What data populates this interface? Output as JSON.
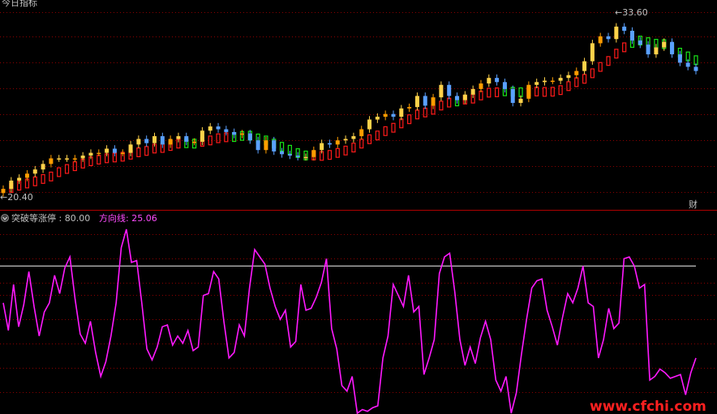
{
  "top_panel": {
    "title_text": "今日指标",
    "price_high_label": "33.60",
    "price_low_label": "20.40",
    "corner_label": "财",
    "colors": {
      "background": "#000000",
      "grid": "#8b0000",
      "up_candle": "#ffd24a",
      "up_candle_alt": "#ff9d00",
      "down_candle": "#5aa0ff",
      "band_red": "#ff1a1a",
      "band_green": "#19e619",
      "axis_text": "#c0c0c0"
    }
  },
  "bottom_panel": {
    "indicator_name": "突破等涨停",
    "level_value": "80.00",
    "line_name": "方向线",
    "line_value": "25.06",
    "colors": {
      "line": "#ff19ff",
      "level_line": "#c0c0c0",
      "name_text": "#c0c0c0",
      "line_label_text": "#ff4dff"
    }
  },
  "watermark": {
    "text": "www.cfchi.com",
    "color": "#ff2020"
  },
  "chart_data": [
    {
      "type": "line",
      "title": "",
      "ylabel": "",
      "ylim": [
        20.4,
        33.6
      ],
      "legend": "none",
      "grid": true,
      "series": [
        {
          "name": "",
          "values": [
            20.8,
            21.4,
            21.6,
            21.9,
            22.2,
            22.6,
            23.0,
            23.0,
            23.0,
            23.0,
            23.2,
            23.4,
            23.4,
            23.7,
            23.4,
            23.4,
            24.0,
            24.4,
            24.1,
            24.6,
            24.0,
            24.4,
            24.6,
            24.2,
            24.2,
            25.0,
            25.3,
            25.1,
            24.9,
            24.7,
            24.8,
            24.3,
            23.6,
            24.3,
            23.5,
            23.3,
            23.2,
            23.1,
            23.1,
            23.6,
            24.1,
            24.0,
            24.3,
            24.4,
            24.6,
            25.1,
            25.8,
            26.0,
            26.2,
            26.0,
            26.6,
            26.7,
            27.5,
            26.8,
            27.4,
            28.3,
            27.5,
            27.2,
            27.6,
            28.0,
            28.4,
            28.8,
            28.5,
            28.0,
            27.0,
            27.3,
            28.3,
            28.5,
            28.6,
            28.6,
            28.8,
            29.0,
            29.3,
            30.0,
            31.3,
            31.8,
            31.6,
            32.5,
            32.2,
            31.5,
            31.2,
            30.5,
            31.0,
            31.4,
            30.5,
            29.9,
            29.6,
            29.3
          ]
        }
      ]
    },
    {
      "type": "line",
      "title": "",
      "ylabel": "",
      "ylim": [
        0,
        100
      ],
      "legend": "none",
      "grid": true,
      "series": [
        {
          "name": "方向线",
          "values": [
            60,
            45,
            70,
            47,
            59,
            77,
            58,
            42,
            55,
            60,
            75,
            65,
            79,
            85,
            62,
            43,
            38,
            50,
            33,
            20,
            28,
            42,
            60,
            90,
            100,
            82,
            83,
            60,
            35,
            29,
            36,
            47,
            48,
            37,
            42,
            38,
            45,
            34,
            36,
            64,
            65,
            77,
            73,
            50,
            30,
            33,
            48,
            42,
            68,
            89,
            85,
            81,
            68,
            58,
            51,
            56,
            36,
            39,
            70,
            56,
            57,
            63,
            71,
            84,
            46,
            35,
            15,
            12,
            20,
            0,
            2,
            1,
            3,
            4,
            30,
            42,
            70,
            64,
            58,
            75,
            55,
            58,
            21,
            30,
            40,
            76,
            85,
            87,
            66,
            40,
            26,
            36,
            27,
            41,
            50,
            40,
            18,
            12,
            20,
            0,
            11,
            32,
            51,
            68,
            72,
            73,
            56,
            47,
            37,
            52,
            65,
            60,
            68,
            80,
            60,
            58,
            30,
            40,
            57,
            46,
            49,
            84,
            85,
            80,
            68,
            70,
            18,
            20,
            24,
            22,
            19,
            20,
            21,
            10,
            22,
            30
          ]
        },
        {
          "name": "level",
          "values": [
            80.0
          ]
        }
      ]
    }
  ]
}
